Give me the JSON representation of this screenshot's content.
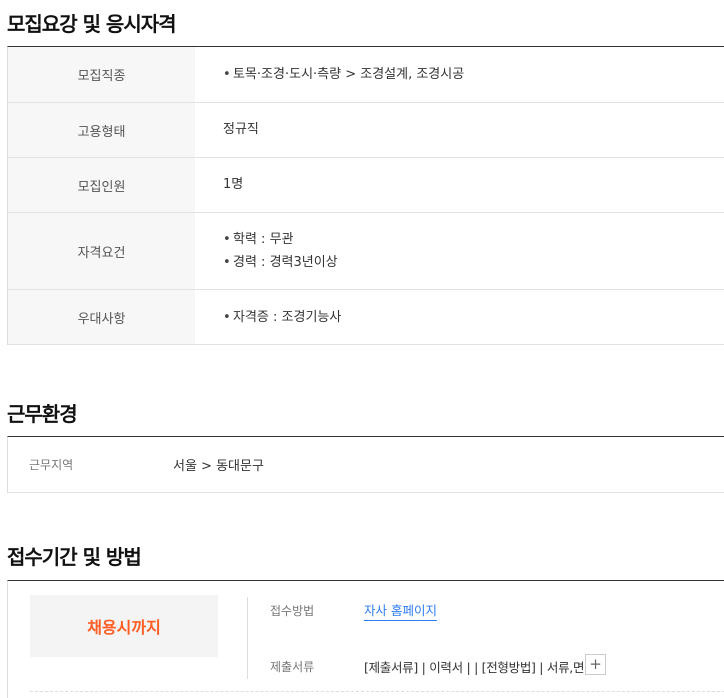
{
  "sections": {
    "requirements_title": "모집요강 및 응시자격",
    "environment_title": "근무환경",
    "application_title": "접수기간 및 방법"
  },
  "requirements": {
    "job_type_label": "모집직종",
    "job_type_value": "토목·조경·도시·측량 > 조경설계, 조경시공",
    "employment_label": "고용형태",
    "employment_value": "정규직",
    "headcount_label": "모집인원",
    "headcount_value": "1명",
    "qualification_label": "자격요건",
    "qualification_items": [
      "학력 : 무관",
      "경력 : 경력3년이상"
    ],
    "preference_label": "우대사항",
    "preference_value": "자격증 : 조경기능사",
    "bullet": "•"
  },
  "environment": {
    "location_label": "근무지역",
    "location_value": "서울 > 동대문구"
  },
  "application": {
    "deadline": "채용시까지",
    "method_label": "접수방법",
    "method_value": "자사 홈페이지",
    "docs_label": "제출서류",
    "docs_value": "[제출서류] | 이력서 | | [전형방법] | 서류,면접",
    "plus_icon": "+"
  },
  "colors": {
    "accent_orange": "#ff5d23",
    "link_blue": "#2d7cf0"
  }
}
